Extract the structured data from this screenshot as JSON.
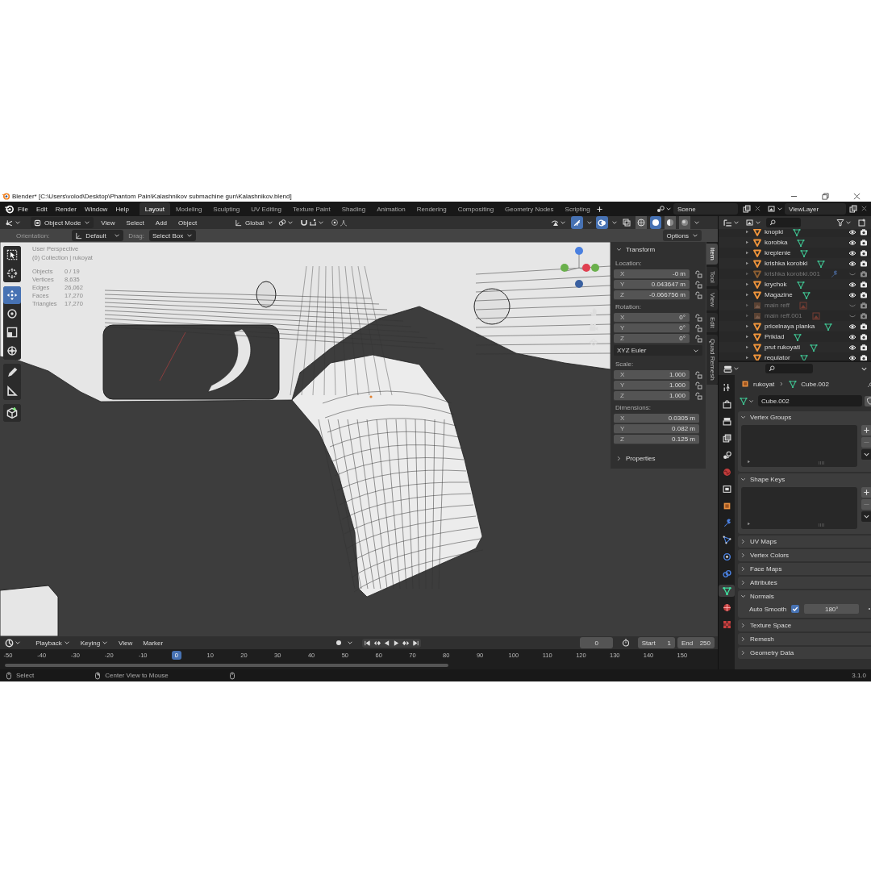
{
  "window": {
    "title": "Blender* [C:\\Users\\volod\\Desktop\\Phantom Pain\\Kalashnikov submachine gun\\Kalashnikov.blend]"
  },
  "menu": [
    "File",
    "Edit",
    "Render",
    "Window",
    "Help"
  ],
  "workspace_tabs": [
    {
      "label": "Layout",
      "selected": true
    },
    {
      "label": "Modeling",
      "selected": false
    },
    {
      "label": "Sculpting",
      "selected": false
    },
    {
      "label": "UV Editing",
      "selected": false
    },
    {
      "label": "Texture Paint",
      "selected": false
    },
    {
      "label": "Shading",
      "selected": false
    },
    {
      "label": "Animation",
      "selected": false
    },
    {
      "label": "Rendering",
      "selected": false
    },
    {
      "label": "Compositing",
      "selected": false
    },
    {
      "label": "Geometry Nodes",
      "selected": false
    },
    {
      "label": "Scripting",
      "selected": false
    }
  ],
  "scene": "Scene",
  "view_layer": "ViewLayer",
  "viewport_header": {
    "mode": "Object Mode",
    "menus": [
      "View",
      "Select",
      "Add",
      "Object"
    ],
    "orientation": "Global",
    "shading": [
      {
        "kind": "wireframe",
        "selected": false
      },
      {
        "kind": "solid",
        "selected": true
      },
      {
        "kind": "material",
        "selected": false
      },
      {
        "kind": "rendered",
        "selected": false
      }
    ]
  },
  "tool_settings": {
    "orientation_label": "Orientation:",
    "orientation": "Default",
    "drag_label": "Drag:",
    "drag": "Select Box",
    "options": "Options"
  },
  "toolbar": [
    {
      "tools": [
        {
          "kind": "select_box",
          "selected": false
        },
        {
          "kind": "cursor",
          "selected": false
        }
      ]
    },
    {
      "tools": [
        {
          "kind": "move",
          "selected": true
        },
        {
          "kind": "rotate",
          "selected": false
        },
        {
          "kind": "scale",
          "selected": false
        },
        {
          "kind": "transform",
          "selected": false
        }
      ]
    },
    {
      "tools": [
        {
          "kind": "annotate",
          "selected": false
        },
        {
          "kind": "measure",
          "selected": false
        }
      ]
    },
    {
      "tools": [
        {
          "kind": "add_cube",
          "selected": false
        }
      ]
    }
  ],
  "viewport_overlay": {
    "view": "User Perspective",
    "collection": "(0) Collection | rukoyat",
    "stats": [
      {
        "label": "Objects",
        "value": "0 / 19"
      },
      {
        "label": "Vertices",
        "value": "8,635"
      },
      {
        "label": "Edges",
        "value": "26,062"
      },
      {
        "label": "Faces",
        "value": "17,270"
      },
      {
        "label": "Triangles",
        "value": "17,270"
      }
    ]
  },
  "n_panel": {
    "tabs": [
      {
        "label": "Item",
        "selected": true
      },
      {
        "label": "Tool",
        "selected": false
      },
      {
        "label": "View",
        "selected": false
      },
      {
        "label": "Edit",
        "selected": false
      },
      {
        "label": "Quad Remesh",
        "selected": false
      }
    ],
    "transform": {
      "title": "Transform",
      "expanded": true,
      "rows": [
        {
          "kind": "label",
          "text": "Location:"
        },
        {
          "kind": "field",
          "axis": "X",
          "value": "-0 m",
          "lock": true
        },
        {
          "kind": "field",
          "axis": "Y",
          "value": "0.043647 m",
          "lock": true
        },
        {
          "kind": "field",
          "axis": "Z",
          "value": "-0.066756 m",
          "lock": true
        },
        {
          "kind": "label",
          "text": "Rotation:"
        },
        {
          "kind": "field",
          "axis": "X",
          "value": "0°",
          "lock": true
        },
        {
          "kind": "field",
          "axis": "Y",
          "value": "0°",
          "lock": true
        },
        {
          "kind": "field",
          "axis": "Z",
          "value": "0°",
          "lock": true
        },
        {
          "kind": "dropdown",
          "text": "XYZ Euler"
        },
        {
          "kind": "label",
          "text": "Scale:"
        },
        {
          "kind": "field",
          "axis": "X",
          "value": "1.000",
          "lock": true
        },
        {
          "kind": "field",
          "axis": "Y",
          "value": "1.000",
          "lock": true
        },
        {
          "kind": "field",
          "axis": "Z",
          "value": "1.000",
          "lock": true
        },
        {
          "kind": "label",
          "text": "Dimensions:"
        },
        {
          "kind": "field",
          "axis": "X",
          "value": "0.0305 m",
          "lock": false
        },
        {
          "kind": "field",
          "axis": "Y",
          "value": "0.082 m",
          "lock": false
        },
        {
          "kind": "field",
          "axis": "Z",
          "value": "0.125 m",
          "lock": false
        }
      ]
    },
    "properties": {
      "title": "Properties",
      "expanded": false
    }
  },
  "outliner": {
    "items": [
      {
        "name": "knopki",
        "kind": "mesh",
        "hidden": false
      },
      {
        "name": "korobka",
        "kind": "mesh",
        "hidden": false
      },
      {
        "name": "kreplenie",
        "kind": "mesh",
        "hidden": false
      },
      {
        "name": "krishka korobki",
        "kind": "mesh",
        "hidden": false
      },
      {
        "name": "krishka korobki.001",
        "kind": "mesh_modifier",
        "hidden": true
      },
      {
        "name": "krychok",
        "kind": "mesh",
        "hidden": false
      },
      {
        "name": "Magazine",
        "kind": "mesh",
        "hidden": false
      },
      {
        "name": "main reff",
        "kind": "image",
        "hidden": true
      },
      {
        "name": "main reff.001",
        "kind": "image",
        "hidden": true
      },
      {
        "name": "pricelnaya planka",
        "kind": "mesh",
        "hidden": false
      },
      {
        "name": "Priklad",
        "kind": "mesh",
        "hidden": false
      },
      {
        "name": "prut rukoyati",
        "kind": "mesh",
        "hidden": false
      },
      {
        "name": "regulator",
        "kind": "mesh",
        "hidden": false
      }
    ]
  },
  "properties": {
    "tabs": [
      {
        "kind": "tool",
        "selected": false
      },
      {
        "kind": "render",
        "selected": false
      },
      {
        "kind": "output",
        "selected": false
      },
      {
        "kind": "view_layer",
        "selected": false
      },
      {
        "kind": "scene",
        "selected": false
      },
      {
        "kind": "world",
        "selected": false
      },
      {
        "kind": "collection",
        "selected": false
      },
      {
        "kind": "object",
        "selected": false
      },
      {
        "kind": "modifiers",
        "selected": false
      },
      {
        "kind": "particles",
        "selected": false
      },
      {
        "kind": "physics",
        "selected": false
      },
      {
        "kind": "constraints",
        "selected": false
      },
      {
        "kind": "data",
        "selected": true
      },
      {
        "kind": "material",
        "selected": false
      },
      {
        "kind": "texture",
        "selected": false
      }
    ],
    "object": "rukoyat",
    "data": "Cube.002",
    "datablock": "Cube.002",
    "panels": [
      {
        "title": "Vertex Groups",
        "kind": "list",
        "expanded": true
      },
      {
        "title": "Shape Keys",
        "kind": "list",
        "expanded": true
      },
      {
        "title": "UV Maps",
        "expanded": false
      },
      {
        "title": "Vertex Colors",
        "expanded": false
      },
      {
        "title": "Face Maps",
        "expanded": false
      },
      {
        "title": "Attributes",
        "expanded": false
      },
      {
        "title": "Normals",
        "kind": "normals",
        "expanded": true,
        "label": "Auto Smooth",
        "checked": true,
        "value": "180°"
      },
      {
        "title": "Texture Space",
        "expanded": false
      },
      {
        "title": "Remesh",
        "expanded": false
      },
      {
        "title": "Geometry Data",
        "expanded": false
      }
    ]
  },
  "timeline": {
    "menus": [
      {
        "label": "Playback",
        "dropdown": true
      },
      {
        "label": "Keying",
        "dropdown": true
      },
      {
        "label": "View",
        "dropdown": false
      },
      {
        "label": "Marker",
        "dropdown": false
      }
    ],
    "current_frame": "0",
    "start_label": "Start",
    "start": "1",
    "end_label": "End",
    "end": "250",
    "ruler": [
      {
        "label": "-50",
        "selected": false
      },
      {
        "label": "-40",
        "selected": false
      },
      {
        "label": "-30",
        "selected": false
      },
      {
        "label": "-20",
        "selected": false
      },
      {
        "label": "-10",
        "selected": false
      },
      {
        "label": "0",
        "selected": true
      },
      {
        "label": "10",
        "selected": false
      },
      {
        "label": "20",
        "selected": false
      },
      {
        "label": "30",
        "selected": false
      },
      {
        "label": "40",
        "selected": false
      },
      {
        "label": "50",
        "selected": false
      },
      {
        "label": "60",
        "selected": false
      },
      {
        "label": "70",
        "selected": false
      },
      {
        "label": "80",
        "selected": false
      },
      {
        "label": "90",
        "selected": false
      },
      {
        "label": "100",
        "selected": false
      },
      {
        "label": "110",
        "selected": false
      },
      {
        "label": "120",
        "selected": false
      },
      {
        "label": "130",
        "selected": false
      },
      {
        "label": "140",
        "selected": false
      },
      {
        "label": "150",
        "selected": false
      }
    ]
  },
  "status_bar": {
    "items": [
      "Select",
      "Center View to Mouse"
    ],
    "version": "3.1.0"
  }
}
